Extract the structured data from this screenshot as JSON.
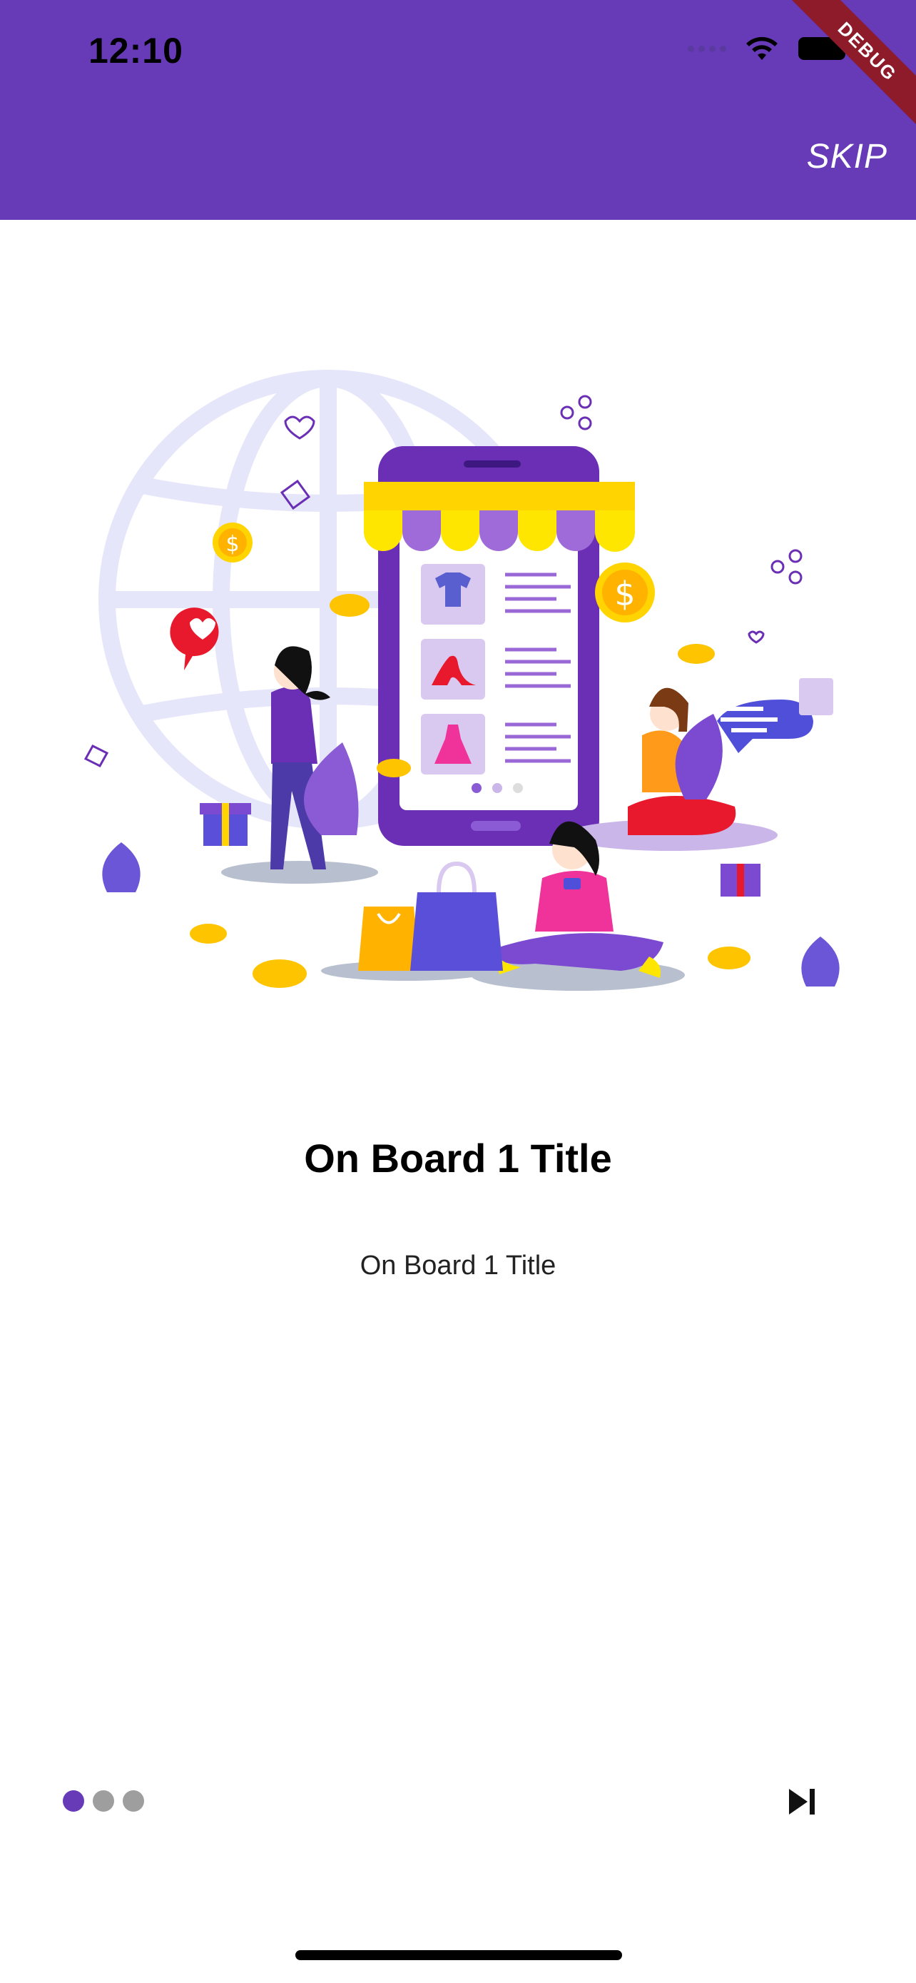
{
  "status_bar": {
    "time": "12:10"
  },
  "app_bar": {
    "skip_label": "SKIP",
    "debug_label": "DEBUG"
  },
  "onboarding": {
    "title": "On Board 1 Title",
    "subtitle": "On Board 1 Title",
    "page_indicator": {
      "total": 3,
      "current": 1
    }
  },
  "colors": {
    "primary": "#673ab7",
    "inactive_dot": "#9e9e9e",
    "background": "#ffffff"
  },
  "icons": {
    "wifi": "wifi-icon",
    "battery": "battery-icon",
    "next": "skip-next-icon"
  }
}
